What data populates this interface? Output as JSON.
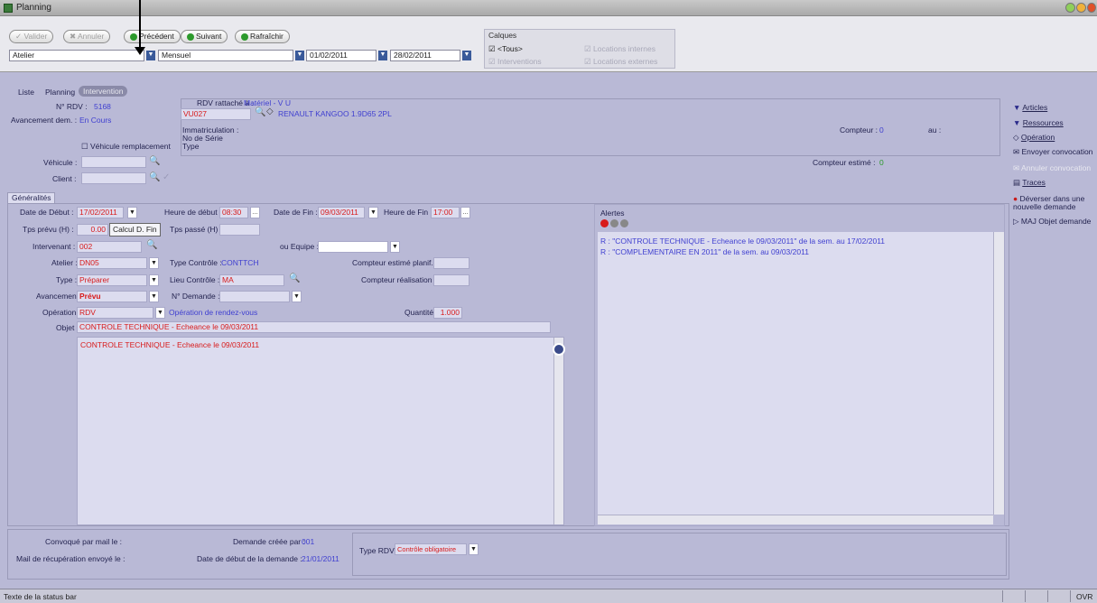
{
  "window": {
    "title": "Planning"
  },
  "toolbar": {
    "valider": "Valider",
    "annuler": "Annuler",
    "precedent": "Précédent",
    "suivant": "Suivant",
    "rafraichir": "Rafraîchir",
    "atelier_select": "Atelier",
    "period_select": "Mensuel",
    "date_from": "01/02/2011",
    "date_to": "28/02/2011"
  },
  "calques": {
    "title": "Calques",
    "tous": "<Tous>",
    "interventions": "Interventions",
    "locations_internes": "Locations internes",
    "locations_externes": "Locations externes"
  },
  "tabs": {
    "liste": "Liste",
    "planning": "Planning",
    "intervention": "Intervention"
  },
  "header": {
    "rdv_label": "N° RDV :",
    "rdv_value": "5168",
    "avancement_label": "Avancement dem. :",
    "avancement_value": "En Cours",
    "vehicule_remplacement": "Véhicule remplacement",
    "vehicule_label": "Véhicule :",
    "client_label": "Client :",
    "rattache_label": "RDV rattaché à :",
    "rattache_value": "Matériel - V U",
    "code": "VU027",
    "vehicle_name": "RENAULT KANGOO 1.9D65 2PL",
    "immatriculation": "Immatriculation :",
    "no_serie": "No de Série",
    "type": "Type",
    "compteur_label": "Compteur :",
    "compteur_value": "0",
    "au_label": "au :",
    "compteur_estime_label": "Compteur estimé :",
    "compteur_estime_value": "0"
  },
  "generalites": {
    "tab": "Généralités",
    "date_debut_label": "Date de Début :",
    "date_debut": "17/02/2011",
    "heure_debut_label": "Heure de début :",
    "heure_debut": "08:30",
    "date_fin_label": "Date de Fin :",
    "date_fin": "09/03/2011",
    "heure_fin_label": "Heure de Fin :",
    "heure_fin": "17:00",
    "tps_prevu_label": "Tps prévu (H) :",
    "tps_prevu": "0.00",
    "calcul_btn": "Calcul D. Fin",
    "tps_passe_label": "Tps passé (H) :",
    "intervenant_label": "Intervenant :",
    "intervenant": "002",
    "equipe_label": "ou Equipe :",
    "atelier_label": "Atelier :",
    "atelier": "DN05",
    "type_controle_label": "Type Contrôle :",
    "type_controle": "CONTTCH",
    "compteur_plan_label": "Compteur estimé planif. :",
    "type_label": "Type :",
    "type_value": "Préparer",
    "lieu_label": "Lieu Contrôle :",
    "lieu": "MA",
    "compteur_real_label": "Compteur réalisation :",
    "avancement_label": "Avancement :",
    "avancement": "Prévu",
    "ndemande_label": "N° Demande :",
    "operation_label": "Opération :",
    "operation": "RDV",
    "operation_desc": "Opération de rendez-vous",
    "quantite_label": "Quantité :",
    "quantite": "1.000",
    "objet_label": "Objet :",
    "objet": "CONTROLE TECHNIQUE - Echeance le 09/03/2011",
    "memo": "CONTROLE TECHNIQUE - Echeance le 09/03/2011"
  },
  "alertes": {
    "title": "Alertes",
    "lines": [
      "R : \"CONTROLE TECHNIQUE - Echeance le 09/03/2011\" de la sem. au 17/02/2011",
      "R : \"COMPLEMENTAIRE EN 2011\" de la sem. au 09/03/2011"
    ]
  },
  "sidebar": {
    "articles": "Articles",
    "ressources": "Ressources",
    "operation": "Opération",
    "envoyer": "Envoyer convocation",
    "annuler_conv": "Annuler convocation",
    "traces": "Traces",
    "deverser": "Déverser dans une nouvelle demande",
    "maj": "MAJ Objet demande"
  },
  "footer": {
    "convoque_label": "Convoqué par mail le :",
    "mail_recup_label": "Mail de récupération envoyé le :",
    "creee_par_label": "Demande créée par :",
    "creee_par": "001",
    "date_debut_dem_label": "Date de début de la demande :",
    "date_debut_dem": "21/01/2011",
    "type_rdv_label": "Type RDV :",
    "type_rdv": "Contrôle obligatoire"
  },
  "status": {
    "text": "Texte de la status bar",
    "right": "OVR"
  },
  "colors": {
    "accent": "#4040d0",
    "alert_red": "#d81b1b",
    "background": "#b9b9d6"
  }
}
